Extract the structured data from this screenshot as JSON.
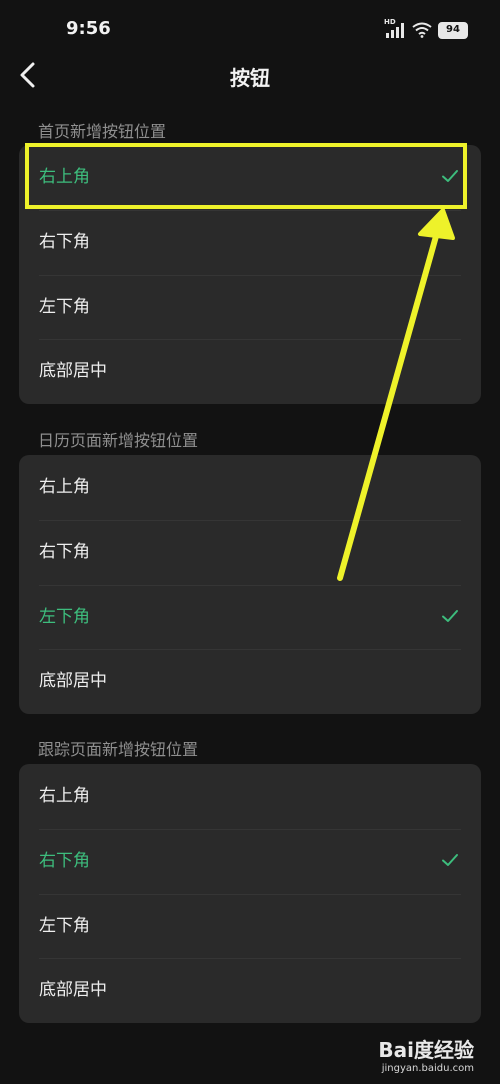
{
  "status_bar": {
    "time": "9:56",
    "battery_level": "94",
    "network_label": "HD",
    "icons": [
      "signal-icon",
      "wifi-icon",
      "battery-icon"
    ]
  },
  "nav": {
    "title": "按钮",
    "back_icon": "chevron-left-icon"
  },
  "sections": [
    {
      "header": "首页新增按钮位置",
      "options": [
        {
          "label": "右上角",
          "selected": true
        },
        {
          "label": "右下角",
          "selected": false
        },
        {
          "label": "左下角",
          "selected": false
        },
        {
          "label": "底部居中",
          "selected": false
        }
      ]
    },
    {
      "header": "日历页面新增按钮位置",
      "options": [
        {
          "label": "右上角",
          "selected": false
        },
        {
          "label": "右下角",
          "selected": false
        },
        {
          "label": "左下角",
          "selected": true
        },
        {
          "label": "底部居中",
          "selected": false
        }
      ]
    },
    {
      "header": "跟踪页面新增按钮位置",
      "options": [
        {
          "label": "右上角",
          "selected": false
        },
        {
          "label": "右下角",
          "selected": true
        },
        {
          "label": "左下角",
          "selected": false
        },
        {
          "label": "底部居中",
          "selected": false
        }
      ]
    }
  ],
  "colors": {
    "background": "#121212",
    "card": "#2a2a2a",
    "selected_accent": "#3dbd7d",
    "annotation": "#eef22a"
  },
  "watermark": {
    "logo": "Bai度经验",
    "url": "jingyan.baidu.com"
  }
}
